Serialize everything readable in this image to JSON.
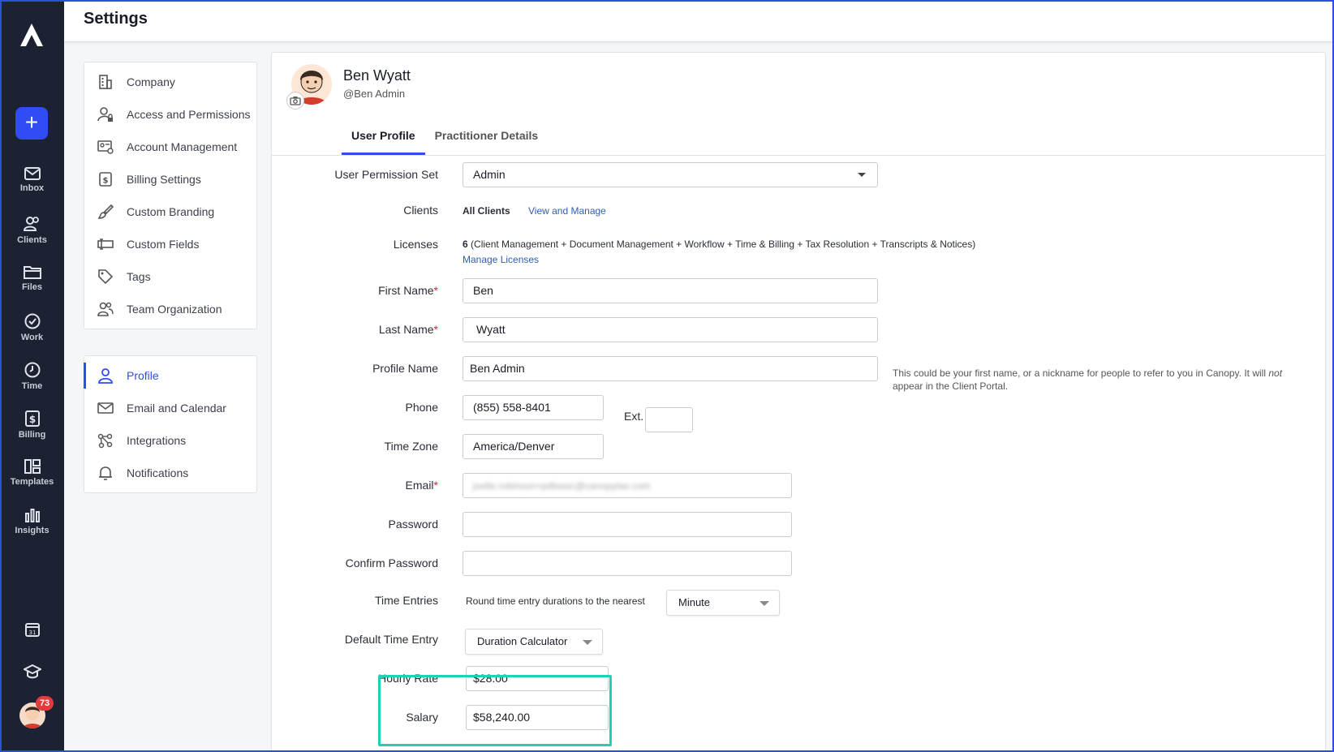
{
  "header": {
    "title": "Settings"
  },
  "rail": {
    "items": [
      {
        "label": "Inbox",
        "icon": "inbox-icon"
      },
      {
        "label": "Clients",
        "icon": "clients-icon"
      },
      {
        "label": "Files",
        "icon": "files-icon"
      },
      {
        "label": "Work",
        "icon": "work-icon"
      },
      {
        "label": "Time",
        "icon": "time-icon"
      },
      {
        "label": "Billing",
        "icon": "billing-icon"
      },
      {
        "label": "Templates",
        "icon": "templates-icon"
      },
      {
        "label": "Insights",
        "icon": "insights-icon"
      }
    ],
    "notification_count": "73"
  },
  "menu": {
    "company_items": [
      {
        "label": "Company"
      },
      {
        "label": "Access and Permissions"
      },
      {
        "label": "Account Management"
      },
      {
        "label": "Billing Settings"
      },
      {
        "label": "Custom Branding"
      },
      {
        "label": "Custom Fields"
      },
      {
        "label": "Tags"
      },
      {
        "label": "Team Organization"
      }
    ],
    "personal_items": [
      {
        "label": "Profile",
        "active": true
      },
      {
        "label": "Email and Calendar"
      },
      {
        "label": "Integrations"
      },
      {
        "label": "Notifications"
      }
    ]
  },
  "profile": {
    "name": "Ben Wyatt",
    "handle": "@Ben Admin",
    "tabs": [
      "User Profile",
      "Practitioner Details"
    ],
    "fields": {
      "permission_set_label": "User Permission Set",
      "permission_set_value": "Admin",
      "clients_label": "Clients",
      "clients_value": "All Clients",
      "clients_link": "View and Manage",
      "licenses_label": "Licenses",
      "licenses_count": "6",
      "licenses_detail": "(Client Management + Document Management + Workflow + Time & Billing + Tax Resolution + Transcripts & Notices)",
      "licenses_link": "Manage Licenses",
      "first_name_label": "First Name",
      "first_name_value": "Ben",
      "last_name_label": "Last Name",
      "last_name_value": "Wyatt",
      "profile_name_label": "Profile Name",
      "profile_name_value": "Ben Admin",
      "profile_name_hint_pre": "This could be your first name, or a nickname for people to refer to you in Canopy. It will ",
      "profile_name_hint_em": "not",
      "profile_name_hint_post": " appear in the Client Portal.",
      "phone_label": "Phone",
      "phone_value": "(855) 558-8401",
      "ext_label": "Ext.",
      "ext_value": "",
      "timezone_label": "Time Zone",
      "timezone_value": "America/Denver",
      "email_label": "Email",
      "email_value": "joelle.robinson+pdbasic@canopytax.com",
      "password_label": "Password",
      "confirm_password_label": "Confirm Password",
      "time_entries_label": "Time Entries",
      "time_entries_text": "Round time entry durations to the nearest",
      "time_entries_value": "Minute",
      "default_time_entry_label": "Default Time Entry",
      "default_time_entry_value": "Duration Calculator",
      "hourly_rate_label": "Hourly Rate",
      "hourly_rate_value": "$28.00",
      "salary_label": "Salary",
      "salary_value": "$58,240.00"
    }
  },
  "colors": {
    "accent": "#2f4cf5",
    "rail_bg": "#1d2233",
    "highlight": "#1fd1b2"
  }
}
